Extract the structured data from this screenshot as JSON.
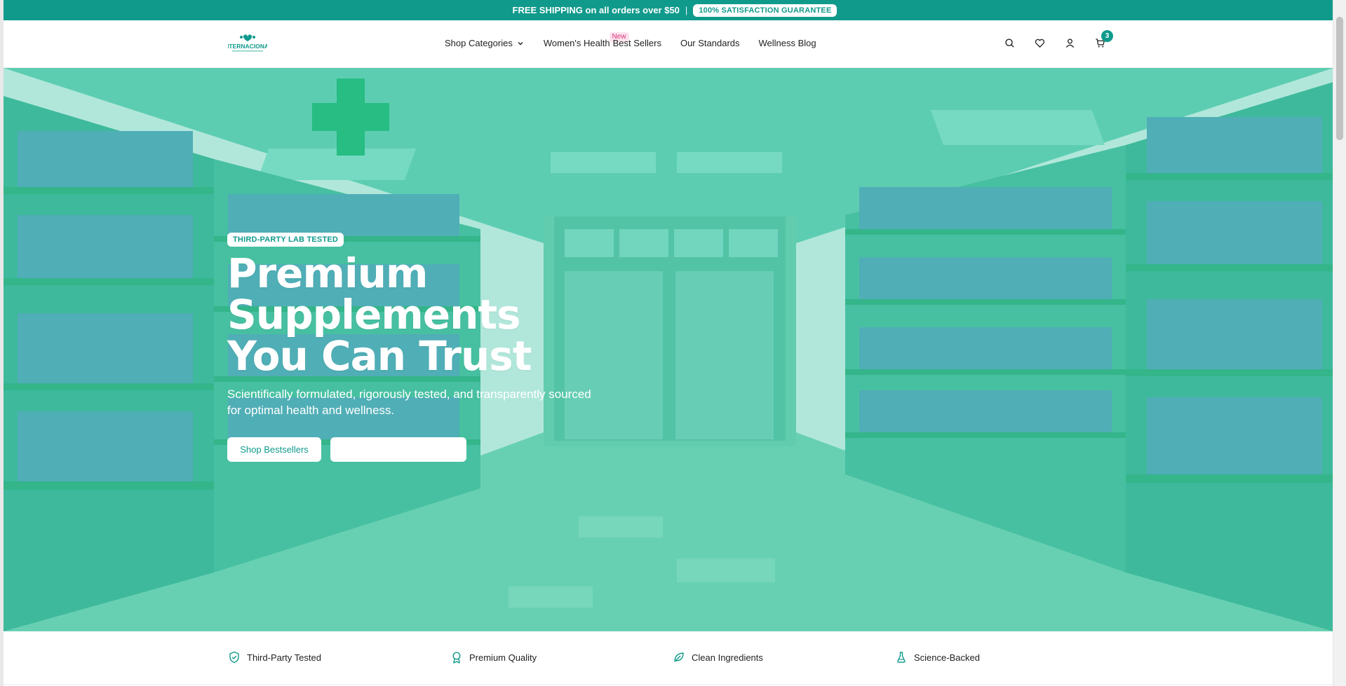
{
  "announcement": {
    "text": "FREE SHIPPING on all orders over $50",
    "separator": "|",
    "pill": "100% SATISFACTION GUARANTEE"
  },
  "header": {
    "logo_text": "INTERNACIONAL",
    "nav": [
      {
        "label": "Shop Categories"
      },
      {
        "label": "Women's Health",
        "badge": "New"
      },
      {
        "label": "Best Sellers"
      },
      {
        "label": "Our Standards"
      },
      {
        "label": "Wellness Blog"
      }
    ],
    "cart_count": "3",
    "icons": [
      "search-icon",
      "heart-icon",
      "user-icon",
      "cart-icon"
    ]
  },
  "hero": {
    "badge": "THIRD-PARTY LAB TESTED",
    "headline_lines": [
      "Premium",
      "Supplements",
      "You Can Trust"
    ],
    "subheading": "Scientifically formulated, rigorously tested, and transparently sourced for optimal health and wellness.",
    "primary_cta": "Shop Bestsellers",
    "secondary_cta": ""
  },
  "trust": [
    {
      "label": "Third-Party Tested",
      "icon": "shield-check-icon"
    },
    {
      "label": "Premium Quality",
      "icon": "award-icon"
    },
    {
      "label": "Clean Ingredients",
      "icon": "leaf-icon"
    },
    {
      "label": "Science-Backed",
      "icon": "flask-icon"
    }
  ],
  "colors": {
    "brand": "#109a8c",
    "badge_pink": "#d6337a",
    "hero_tint": "#20b996"
  }
}
